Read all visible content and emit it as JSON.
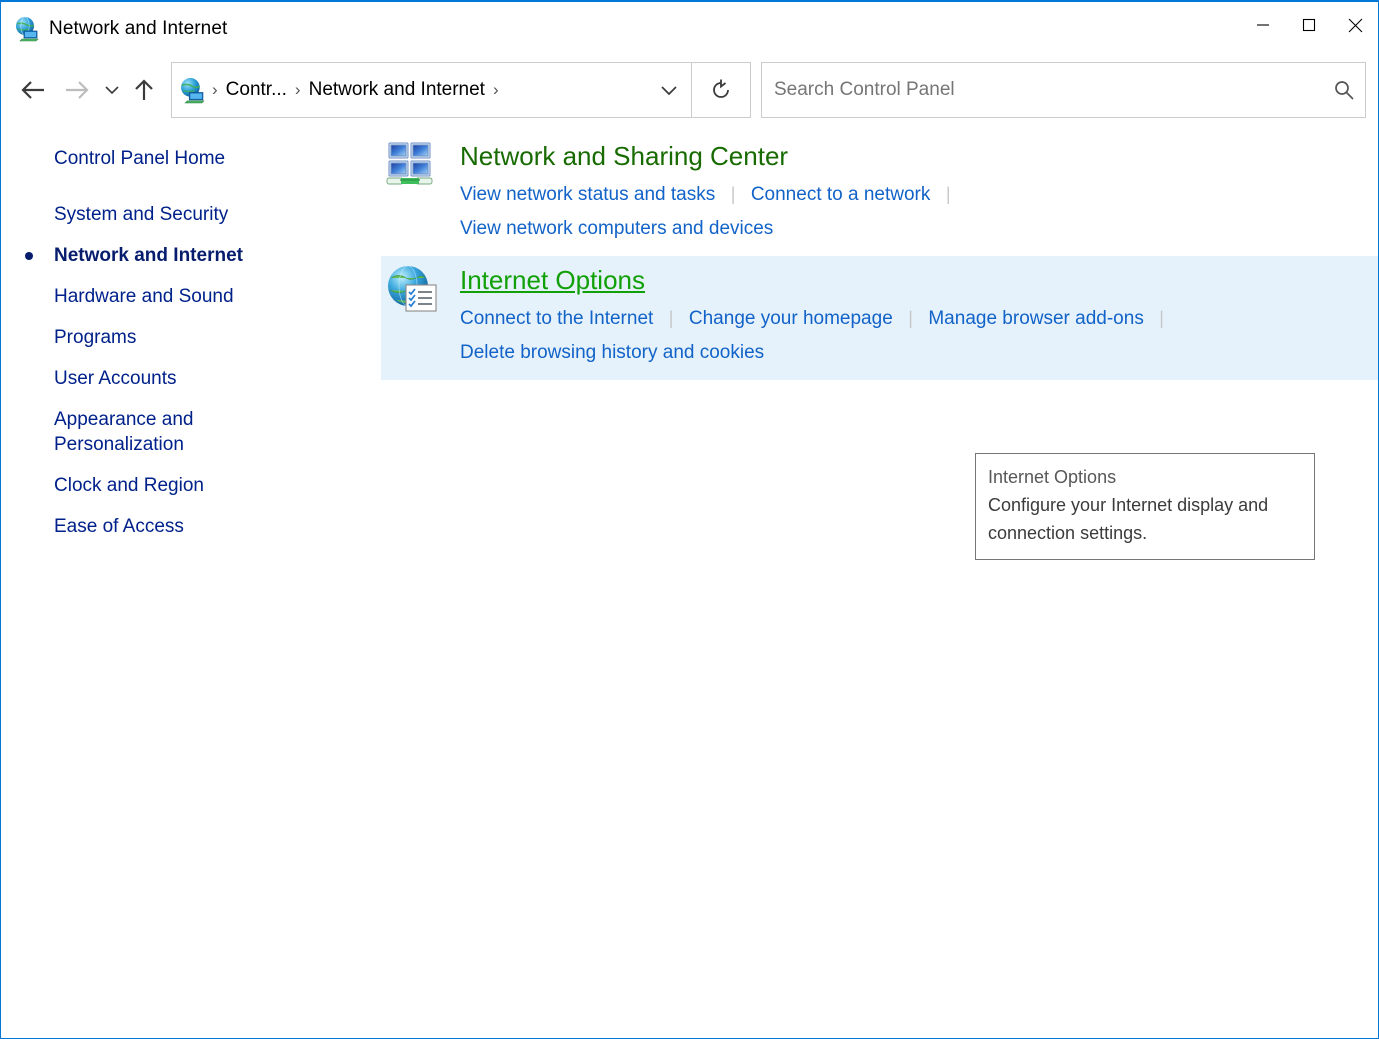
{
  "window": {
    "title": "Network and Internet",
    "title_icon": "network-internet-icon",
    "minimize_label": "Minimize",
    "maximize_label": "Maximize",
    "close_label": "Close",
    "accent_color": "#0078d7"
  },
  "nav": {
    "back_label": "Back",
    "forward_label": "Forward",
    "recent_label": "Recent locations",
    "up_label": "Up to Control Panel",
    "refresh_label": "Refresh",
    "crumb_icon": "network-internet-icon",
    "breadcrumbs": [
      {
        "label": "Contr...",
        "separator": "›"
      },
      {
        "label": "Network and Internet",
        "separator": "›"
      }
    ],
    "dropdown_label": "Previous locations"
  },
  "search": {
    "placeholder": "Search Control Panel",
    "value": "",
    "icon": "search-icon"
  },
  "sidebar": {
    "home": {
      "label": "Control Panel Home",
      "current": false
    },
    "items": [
      {
        "label": "System and Security",
        "current": false
      },
      {
        "label": "Network and Internet",
        "current": true
      },
      {
        "label": "Hardware and Sound",
        "current": false
      },
      {
        "label": "Programs",
        "current": false
      },
      {
        "label": "User Accounts",
        "current": false
      },
      {
        "label": "Appearance and\nPersonalization",
        "current": false
      },
      {
        "label": "Clock and Region",
        "current": false
      },
      {
        "label": "Ease of Access",
        "current": false
      }
    ]
  },
  "content": {
    "categories": [
      {
        "id": "network-and-sharing-center",
        "icon": "network-sharing-center-icon",
        "title": "Network and Sharing Center",
        "hovered": false,
        "title_color": "#176b00",
        "rows": [
          [
            "View network status and tasks",
            "Connect to a network"
          ],
          [
            "View network computers and devices"
          ]
        ],
        "trailing_separator_rows": [
          true,
          false
        ]
      },
      {
        "id": "internet-options",
        "icon": "internet-options-icon",
        "title": "Internet Options",
        "hovered": true,
        "title_color": "#11a007",
        "highlight_color": "#e5f1fb",
        "rows": [
          [
            "Connect to the Internet",
            "Change your homepage",
            "Manage browser add-ons"
          ],
          [
            "Delete browsing history and cookies"
          ]
        ],
        "trailing_separator_rows": [
          true,
          false
        ]
      }
    ]
  },
  "tooltip": {
    "visible": true,
    "title": "Internet Options",
    "description": "Configure your Internet display and connection settings."
  }
}
